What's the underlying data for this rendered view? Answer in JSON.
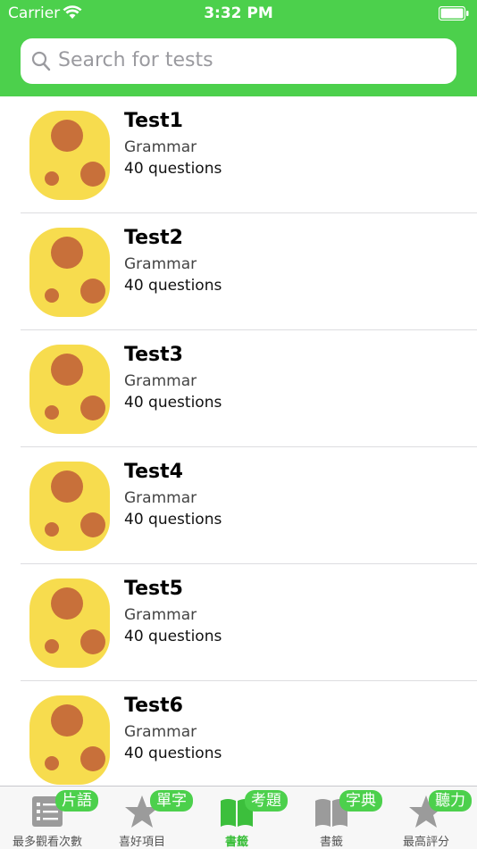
{
  "status_bar": {
    "carrier": "Carrier",
    "time": "3:32 PM"
  },
  "search": {
    "placeholder": "Search for tests"
  },
  "tests": [
    {
      "title": "Test1",
      "category": "Grammar",
      "count": "40 questions"
    },
    {
      "title": "Test2",
      "category": "Grammar",
      "count": "40 questions"
    },
    {
      "title": "Test3",
      "category": "Grammar",
      "count": "40 questions"
    },
    {
      "title": "Test4",
      "category": "Grammar",
      "count": "40 questions"
    },
    {
      "title": "Test5",
      "category": "Grammar",
      "count": "40 questions"
    },
    {
      "title": "Test6",
      "category": "Grammar",
      "count": "40 questions"
    }
  ],
  "tabs": [
    {
      "label": "最多觀看次數",
      "badge": "片語",
      "icon": "list-icon",
      "active": false
    },
    {
      "label": "喜好項目",
      "badge": "單字",
      "icon": "star-icon",
      "active": false
    },
    {
      "label": "書籤",
      "badge": "考題",
      "icon": "book-icon",
      "active": true
    },
    {
      "label": "書籤",
      "badge": "字典",
      "icon": "book-icon",
      "active": false
    },
    {
      "label": "最高評分",
      "badge": "聽力",
      "icon": "star-icon",
      "active": false
    }
  ],
  "colors": {
    "accent": "#4cd04c",
    "active_tab": "#3cbf3c",
    "inactive_icon": "#9b9b9b",
    "thumb_yellow": "#f7dc4e",
    "thumb_spot": "#c8703a"
  }
}
